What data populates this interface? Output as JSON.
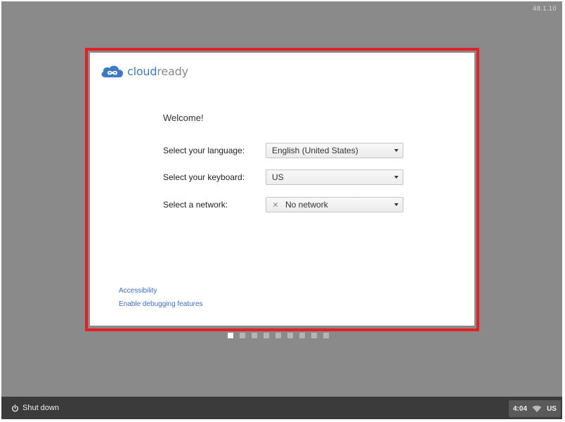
{
  "version": "48.1.10",
  "brand": {
    "logo_text_primary": "cloud",
    "logo_text_secondary": "ready",
    "colors": {
      "blue": "#3d7bc4",
      "gray": "#8a8a8a",
      "highlight": "#e32026",
      "link": "#3a6fc7"
    }
  },
  "welcome": {
    "title": "Welcome!"
  },
  "form": {
    "language": {
      "label": "Select your language:",
      "value": "English (United States)"
    },
    "keyboard": {
      "label": "Select your keyboard:",
      "value": "US"
    },
    "network": {
      "label": "Select a network:",
      "value": "No network",
      "icon": "no-network-icon"
    }
  },
  "links": {
    "accessibility": "Accessibility",
    "debugging": "Enable debugging features"
  },
  "pagination": {
    "total": 9,
    "current": 1
  },
  "shelf": {
    "shutdown_label": "Shut down",
    "time": "4:04",
    "keyboard_layout": "US",
    "wifi_icon": "wifi-icon"
  }
}
